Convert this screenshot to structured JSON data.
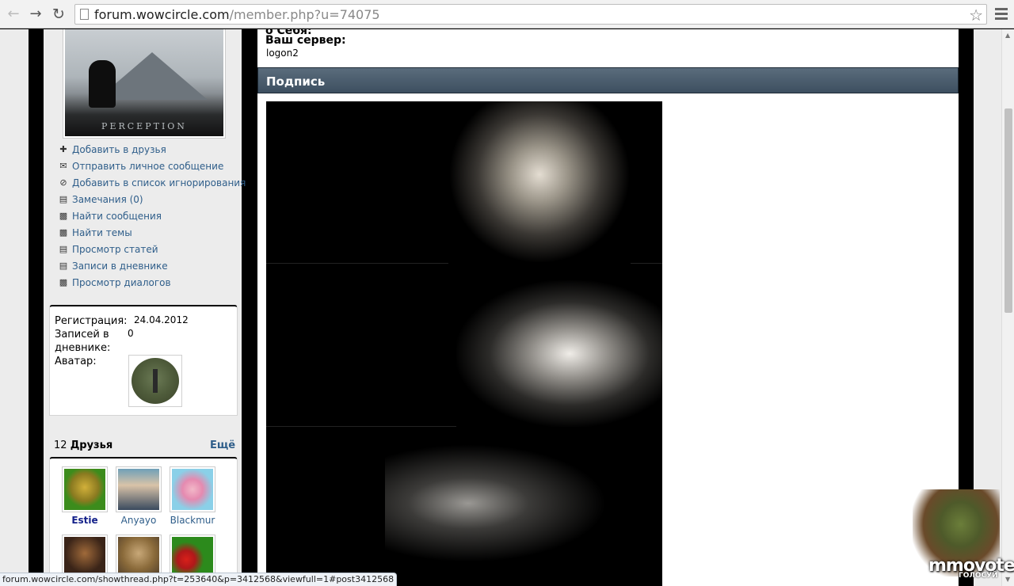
{
  "browser": {
    "url_host": "forum.wowcircle.com",
    "url_path": "/member.php?u=74075"
  },
  "sidebar": {
    "profile_caption": "PERCEPTION",
    "actions": [
      {
        "icon": "plus-icon",
        "label": "Добавить в друзья"
      },
      {
        "icon": "envelope-icon",
        "label": "Отправить личное сообщение"
      },
      {
        "icon": "block-icon",
        "label": "Добавить в список игнорирования"
      },
      {
        "icon": "note-icon",
        "label": "Замечания (0)"
      },
      {
        "icon": "posts-icon",
        "label": "Найти сообщения"
      },
      {
        "icon": "posts-icon",
        "label": "Найти темы"
      },
      {
        "icon": "article-icon",
        "label": "Просмотр статей"
      },
      {
        "icon": "diary-icon",
        "label": "Записи в дневнике"
      },
      {
        "icon": "dialog-icon",
        "label": "Просмотр диалогов"
      }
    ],
    "info": {
      "reg_label": "Регистрация:",
      "reg_value": "24.04.2012",
      "diary_label_1": "Записей в",
      "diary_label_2": "дневнике:",
      "diary_value": "0",
      "avatar_label": "Аватар:"
    },
    "friends": {
      "count": "12",
      "title": "Друзья",
      "more": "Ещё",
      "list": [
        {
          "name": "Estie",
          "bold": true,
          "color": "#3c8c1c"
        },
        {
          "name": "Anyayo",
          "bold": false,
          "color": "#3a4a5e"
        },
        {
          "name": "Blackmur",
          "bold": false,
          "color": "#8ad0e8"
        },
        {
          "name": "",
          "bold": false,
          "color": "#3a2418"
        },
        {
          "name": "",
          "bold": false,
          "color": "#8a6a3a"
        },
        {
          "name": "",
          "bold": false,
          "color": "#2c8a1c"
        }
      ]
    }
  },
  "main": {
    "field_partial": "о Себя:",
    "server_label": "Ваш сервер:",
    "server_value": "logon2",
    "signature_title": "Подпись"
  },
  "status_bar": "forum.wowcircle.com/showthread.php?t=253640&p=3412568&viewfull=1#post3412568",
  "promo": {
    "logo": "mmovote",
    "sub": "ГОЛОСУЙ"
  }
}
